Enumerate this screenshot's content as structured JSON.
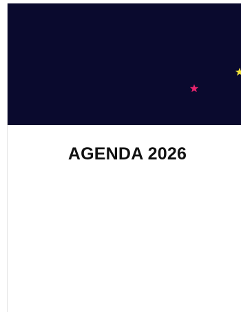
{
  "card": {
    "title": "AGENDA 2026"
  },
  "colors": {
    "hero_background": "#0a0a2e",
    "star_pink": "#e8246e",
    "star_yellow": "#f2e23a",
    "title_text": "#111111"
  },
  "icons": [
    "star-pink-icon",
    "star-yellow-icon"
  ]
}
